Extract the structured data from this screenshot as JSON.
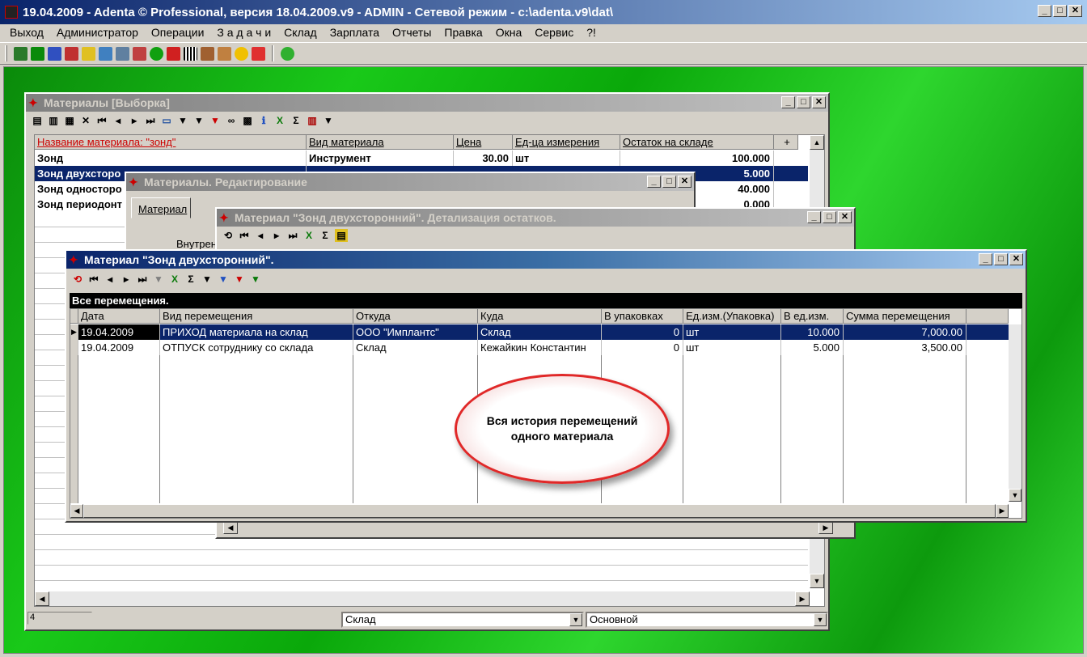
{
  "app": {
    "title": "19.04.2009 - Adenta © Professional, версия 18.04.2009.v9 - ADMIN - Сетевой режим - c:\\adenta.v9\\dat\\"
  },
  "menu": [
    "Выход",
    "Администратор",
    "Операции",
    "З а д а ч и",
    "Склад",
    "Зарплата",
    "Отчеты",
    "Правка",
    "Окна",
    "Сервис",
    "?!"
  ],
  "materials_window": {
    "title": "Материалы [Выборка]",
    "columns": [
      "Название материала: \"зонд\"",
      "Вид материала",
      "Цена",
      "Ед-ца измерения",
      "Остаток на складе",
      "+"
    ],
    "rows": [
      [
        "Зонд",
        "Инструмент",
        "30.00",
        "шт",
        "100.000"
      ],
      [
        "Зонд двухсторо",
        "",
        "",
        "",
        "5.000"
      ],
      [
        "Зонд односторо",
        "",
        "",
        "",
        "40.000"
      ],
      [
        "Зонд периодонт",
        "",
        "",
        "",
        "0.000"
      ]
    ],
    "status_count": "4",
    "combo_store": "Склад",
    "combo_main": "Основной"
  },
  "edit_window": {
    "title": "Материалы. Редактирование",
    "tab": "Материал",
    "label": "Внутрен"
  },
  "detail_window": {
    "title": "Материал \"Зонд двухсторонний\". Детализация остатков."
  },
  "moves_window": {
    "title": "Материал \"Зонд двухсторонний\".",
    "caption": "Все перемещения.",
    "columns": [
      "Дата",
      "Вид перемещения",
      "Откуда",
      "Куда",
      "В упаковках",
      "Ед.изм.(Упаковка)",
      "В ед.изм.",
      "Сумма перемещения"
    ],
    "rows": [
      [
        "19.04.2009",
        "ПРИХОД материала на склад",
        "ООО \"Имплантс\"",
        "Склад",
        "0",
        "шт",
        "10.000",
        "7,000.00"
      ],
      [
        "19.04.2009",
        "ОТПУСК сотруднику со склада",
        "Склад",
        "Кежайкин Константин",
        "0",
        "шт",
        "5.000",
        "3,500.00"
      ]
    ]
  },
  "callout": {
    "text": "Вся история перемещений одного материала"
  }
}
